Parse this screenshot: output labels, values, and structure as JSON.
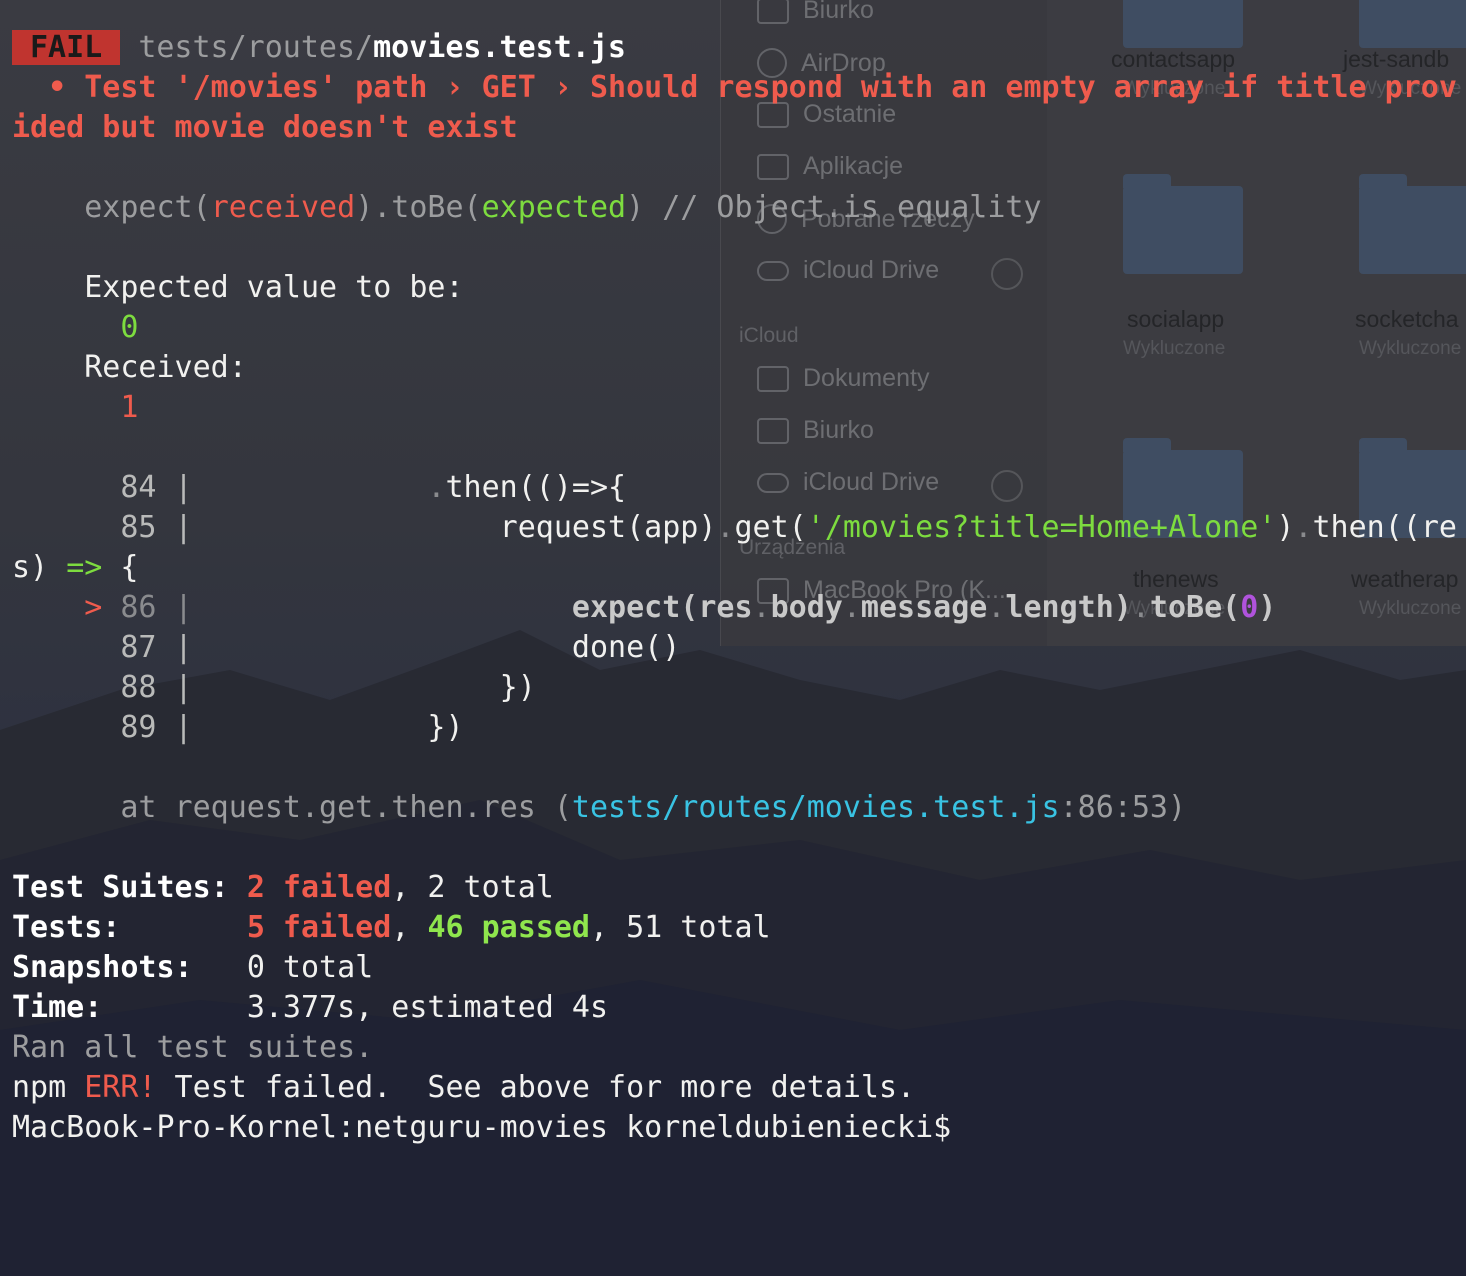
{
  "background": {
    "finder": {
      "sidebar": [
        {
          "label": "Biurko",
          "icon": "desktop-icon"
        },
        {
          "label": "AirDrop",
          "icon": "airdrop-icon"
        },
        {
          "label": "Ostatnie",
          "icon": "recent-icon"
        },
        {
          "label": "Aplikacje",
          "icon": "applications-icon"
        },
        {
          "label": "Pobrane rzeczy",
          "icon": "download-icon"
        },
        {
          "label": "iCloud Drive",
          "icon": "cloud-icon"
        }
      ],
      "section_icloud": "iCloud",
      "icloud_items": [
        {
          "label": "Dokumenty",
          "icon": "document-icon"
        },
        {
          "label": "Biurko",
          "icon": "desktop-icon"
        },
        {
          "label": "iCloud Drive",
          "icon": "cloud-icon"
        }
      ],
      "section_devices": "Urządzenia",
      "device_item": "MacBook Pro (K...",
      "folders": [
        {
          "name": "contactsapp",
          "sub": "Wykluczone"
        },
        {
          "name": "jest-sandb",
          "sub": "Wykluczone"
        },
        {
          "name": "socialapp",
          "sub": "Wykluczone"
        },
        {
          "name": "socketcha",
          "sub": "Wykluczone"
        },
        {
          "name": "thenews",
          "sub": "Wykluczone"
        },
        {
          "name": "weatherap",
          "sub": "Wykluczone"
        }
      ]
    }
  },
  "terminal": {
    "fail_badge": "FAIL",
    "file_dir": "tests/routes/",
    "file_name": "movies.test.js",
    "test_title_1": "  • Test '/movies' path › GET › Should respond with an empty array if title prov",
    "test_title_2": "ided but movie doesn't exist",
    "assert": {
      "p1": "    expect(",
      "received": "received",
      "p2": ").toBe(",
      "expected": "expected",
      "p3": ") // Object.is equality"
    },
    "expected_label": "    Expected value to be:",
    "expected_value": "      0",
    "received_label": "    Received:",
    "received_value": "      1",
    "code": {
      "l84_num": "      84 |",
      "l84_a": "             .",
      "l84_b": "then(()=>{",
      "l85_num": "      85 |",
      "l85_a": "                 request(app)",
      "l85_dot": ".",
      "l85_b": "get(",
      "l85_str": "'/movies?title=Home+Alone'",
      "l85_c": ")",
      "l85_d": "then((re",
      "l85_wrap_a": "s) ",
      "l85_wrap_arrow": "=>",
      "l85_wrap_b": " {",
      "l86_marker": "    > ",
      "l86_num": "86 |",
      "l86_a": "                     expect(res",
      "l86_b": "body",
      "l86_c": "message",
      "l86_d": "length)",
      "l86_e": "toBe(",
      "l86_val": "0",
      "l86_f": ")",
      "l87_num": "      87 |",
      "l87_code": "                     done()",
      "l88_num": "      88 |",
      "l88_code": "                 })",
      "l89_num": "      89 |",
      "l89_code": "             })"
    },
    "stack": {
      "prefix": "      at request.get.then.res (",
      "path": "tests/routes/movies.test.js",
      "pos": ":86:53)"
    },
    "summary": {
      "suites_label": "Test Suites:",
      "suites_failed": "2 failed",
      "suites_total": ", 2 total",
      "tests_label": "Tests:",
      "tests_failed": "5 failed",
      "tests_passed": "46 passed",
      "tests_total": ", 51 total",
      "snapshots_label": "Snapshots:",
      "snapshots_value": "0 total",
      "time_label": "Time:",
      "time_value": "3.377s, estimated 4s",
      "ran_all": "Ran all test suites."
    },
    "npm_err": {
      "npm": "npm ",
      "err": "ERR!",
      "msg": " Test failed.  See above for more details."
    },
    "prompt": "MacBook-Pro-Kornel:netguru-movies korneldubieniecki$"
  }
}
